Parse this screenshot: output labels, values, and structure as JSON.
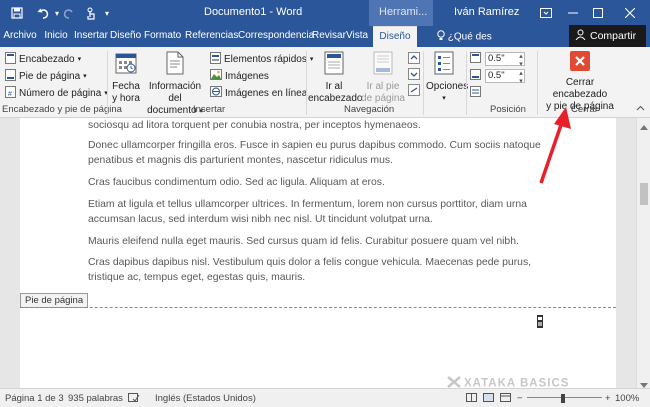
{
  "titlebar": {
    "doc_title": "Documento1 - Word",
    "context_tab": "Herrami...",
    "user": "Iván Ramírez"
  },
  "tabs": [
    {
      "label": "Archivo"
    },
    {
      "label": "Inicio"
    },
    {
      "label": "Insertar"
    },
    {
      "label": "Diseño"
    },
    {
      "label": "Formato"
    },
    {
      "label": "Referencias"
    },
    {
      "label": "Correspondencia"
    },
    {
      "label": "Revisar"
    },
    {
      "label": "Vista"
    },
    {
      "label": "Diseño"
    }
  ],
  "tellme": "¿Qué des",
  "share": "Compartir",
  "ribbon": {
    "header_footer": {
      "encabezado": "Encabezado",
      "pie": "Pie de página",
      "numero": "Número de página",
      "label": "Encabezado y pie de página"
    },
    "insertar": {
      "fecha_l1": "Fecha",
      "fecha_l2": "y hora",
      "info_l1": "Información del",
      "info_l2": "documento",
      "elementos": "Elementos rápidos",
      "imagenes": "Imágenes",
      "imagenes_linea": "Imágenes en línea",
      "label": "Insertar"
    },
    "navegacion": {
      "ir_enc_l1": "Ir al",
      "ir_enc_l2": "encabezado",
      "ir_pie_l1": "Ir al pie",
      "ir_pie_l2": "de página",
      "label": "Navegación"
    },
    "opciones": {
      "label": "Opciones"
    },
    "posicion": {
      "top": "0.5\"",
      "bottom": "0.5\"",
      "label": "Posición"
    },
    "cerrar": {
      "btn_l1": "Cerrar encabezado",
      "btn_l2": "y pie de página",
      "label": "Cerrar"
    }
  },
  "document": {
    "paragraphs": [
      "sociosqu ad litora torquent per conubia nostra, per inceptos hymenaeos.",
      "Donec ullamcorper fringilla eros. Fusce in sapien eu purus dapibus commodo. Cum sociis natoque penatibus et magnis dis parturient montes, nascetur ridiculus mus.",
      "Cras faucibus condimentum odio. Sed ac ligula. Aliquam at eros.",
      "Etiam at ligula et tellus ullamcorper ultrices. In fermentum, lorem non cursus porttitor, diam urna accumsan lacus, sed interdum wisi nibh nec nisl. Ut tincidunt volutpat urna.",
      "Mauris eleifend nulla eget mauris. Sed cursus quam id felis. Curabitur posuere quam vel nibh.",
      "Cras dapibus dapibus nisl. Vestibulum quis dolor a felis congue vehicula. Maecenas pede purus, tristique ac, tempus eget, egestas quis, mauris."
    ],
    "footer_tag": "Pie de página"
  },
  "status": {
    "page": "Página 1 de 3",
    "words": "935 palabras",
    "language": "Inglés (Estados Unidos)",
    "zoom": "100%"
  },
  "watermark": "XATAKA BASICS",
  "colors": {
    "accent": "#2b579a",
    "close_red": "#e04a32",
    "arrow_red": "#e8202a"
  }
}
